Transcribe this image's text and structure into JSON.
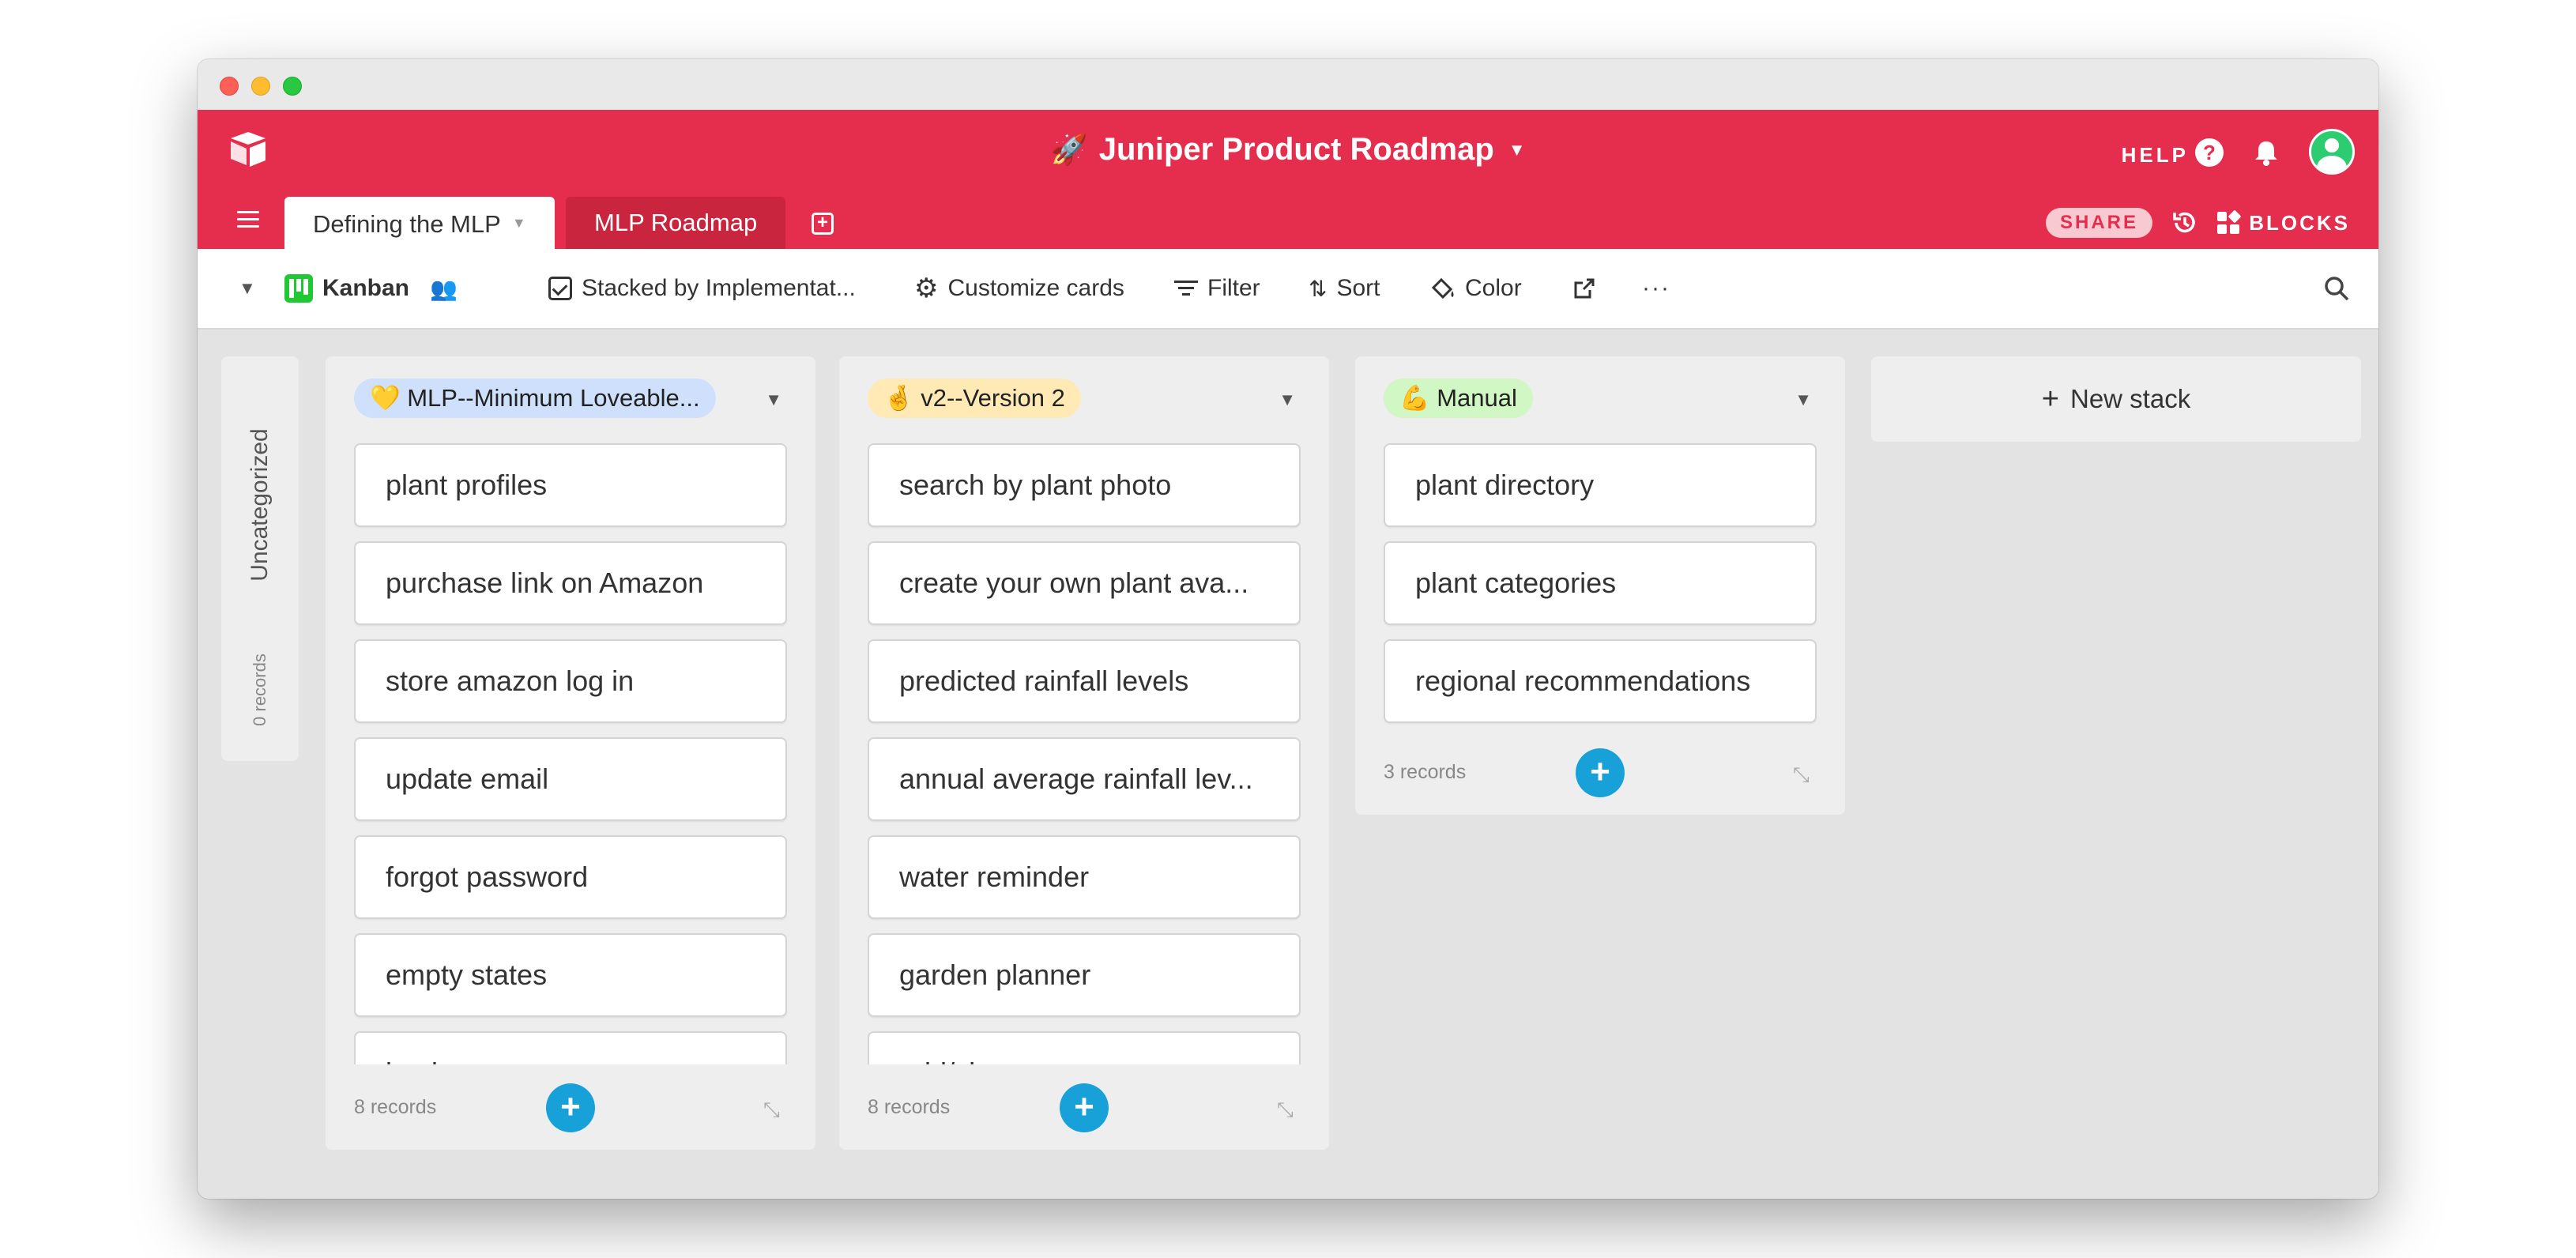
{
  "app": {
    "base_title": "Juniper Product Roadmap",
    "help_label": "HELP",
    "share_label": "SHARE",
    "blocks_label": "BLOCKS"
  },
  "tabs": [
    {
      "label": "Defining the MLP",
      "active": true
    },
    {
      "label": "MLP Roadmap",
      "active": false
    }
  ],
  "viewbar": {
    "view_name": "Kanban",
    "stacked_by": "Stacked by Implementat...",
    "customize": "Customize cards",
    "filter": "Filter",
    "sort": "Sort",
    "color": "Color",
    "more": "···"
  },
  "uncategorized": {
    "label": "Uncategorized",
    "count": "0 records"
  },
  "stacks": [
    {
      "emoji": "💛",
      "title": "MLP--Minimum Loveable...",
      "color": "#cfe0fc",
      "cards": [
        "plant profiles",
        "purchase link on Amazon",
        "store amazon log in",
        "update email",
        "forgot password",
        "empty states",
        "log in"
      ],
      "count": "8 records"
    },
    {
      "emoji": "🤞",
      "title": "v2--Version 2",
      "color": "#ffeab6",
      "cards": [
        "search by plant photo",
        "create your own plant ava...",
        "predicted rainfall levels",
        "annual average rainfall lev...",
        "water reminder",
        "garden planner",
        "add/ch..."
      ],
      "count": "8 records"
    },
    {
      "emoji": "💪",
      "title": "Manual",
      "color": "#d1f7c4",
      "cards": [
        "plant directory",
        "plant categories",
        "regional recommendations"
      ],
      "count": "3 records"
    }
  ],
  "new_stack_label": "New stack",
  "colors": {
    "brand": "#e52e4d",
    "add_button": "#18a0d8",
    "kanban_icon": "#20c933"
  }
}
